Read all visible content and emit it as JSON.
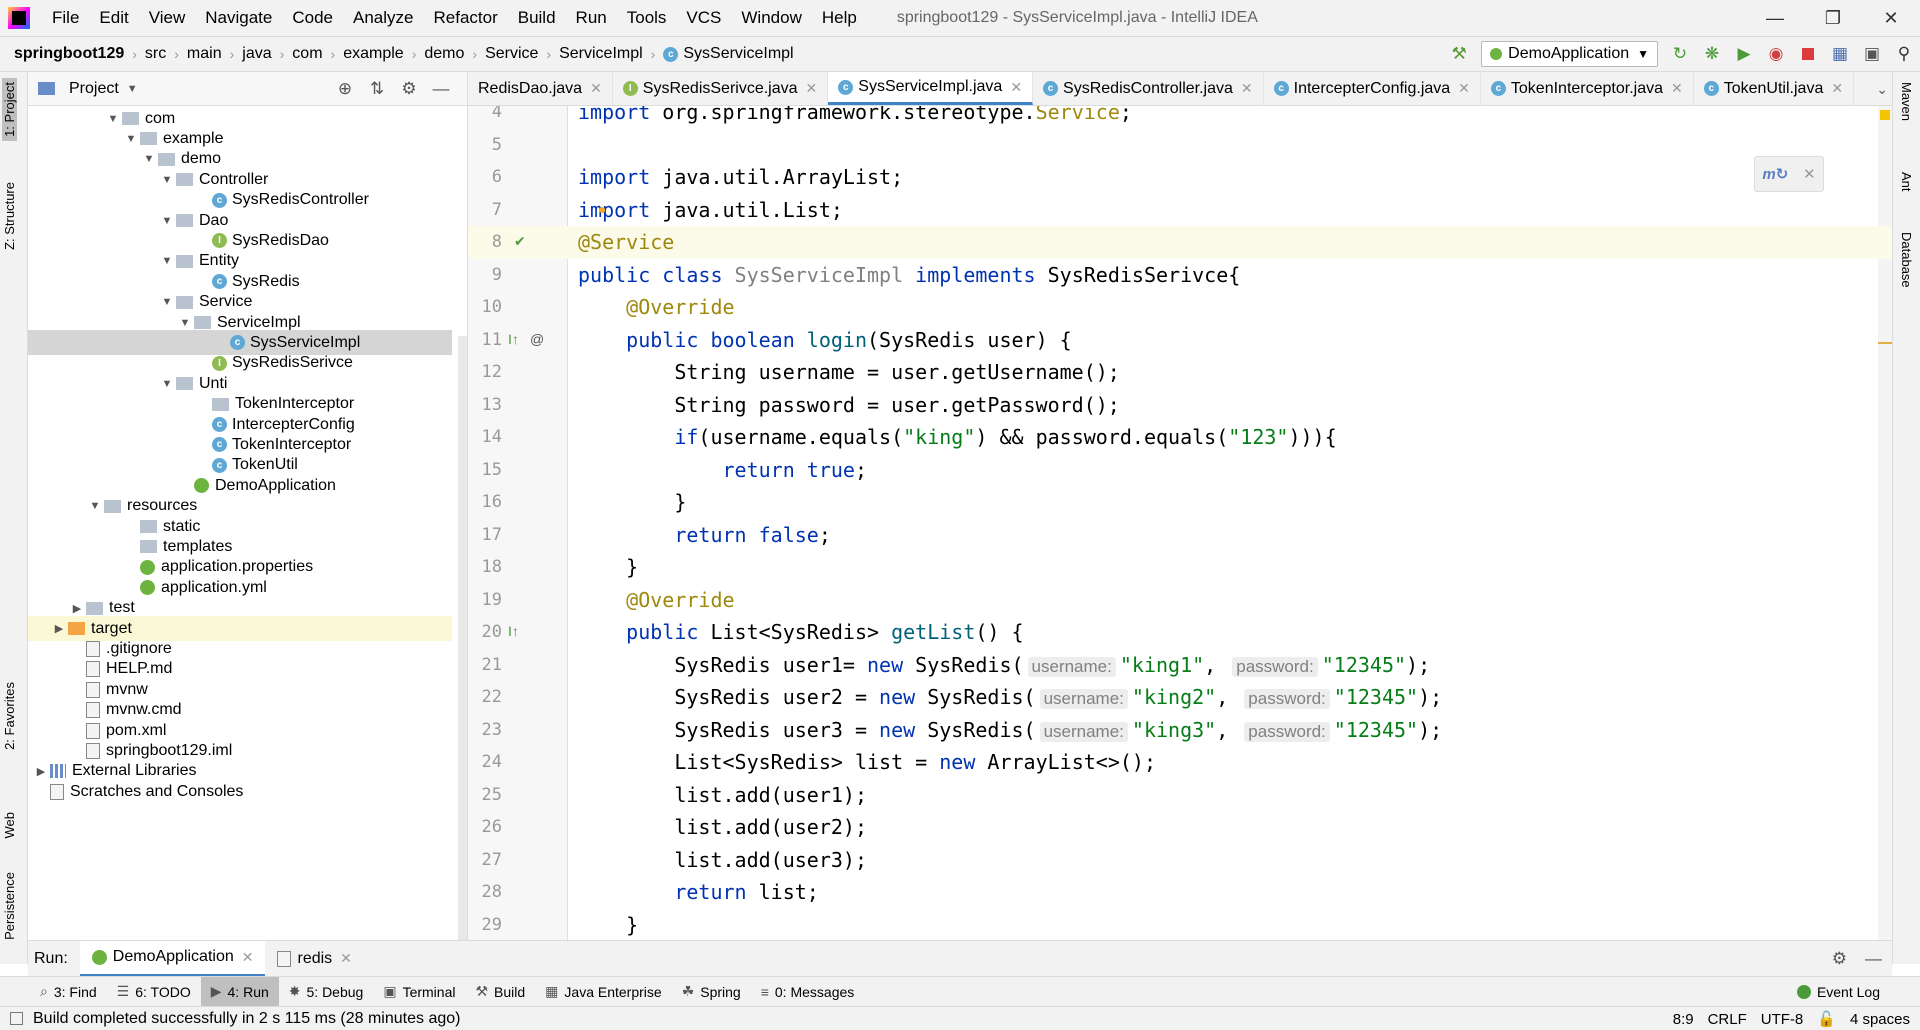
{
  "menu": {
    "items": [
      "File",
      "Edit",
      "View",
      "Navigate",
      "Code",
      "Analyze",
      "Refactor",
      "Build",
      "Run",
      "Tools",
      "VCS",
      "Window",
      "Help"
    ],
    "window_title": "springboot129 - SysServiceImpl.java - IntelliJ IDEA"
  },
  "breadcrumb": [
    "springboot129",
    "src",
    "main",
    "java",
    "com",
    "example",
    "demo",
    "Service",
    "ServiceImpl",
    "SysServiceImpl"
  ],
  "run_config": "DemoApplication",
  "left_stripe": {
    "project": "1: Project",
    "structure": "Z: Structure",
    "favorites": "2: Favorites",
    "web": "Web",
    "persistence": "Persistence"
  },
  "right_stripe": {
    "maven": "Maven",
    "ant": "Ant",
    "database": "Database"
  },
  "project_panel": {
    "title": "Project",
    "tree": [
      {
        "label": "com",
        "type": "package",
        "level": 4,
        "expanded": true
      },
      {
        "label": "example",
        "type": "package",
        "level": 5,
        "expanded": true
      },
      {
        "label": "demo",
        "type": "package",
        "level": 6,
        "expanded": true
      },
      {
        "label": "Controller",
        "type": "package",
        "level": 7,
        "expanded": true
      },
      {
        "label": "SysRedisController",
        "type": "class",
        "level": 9
      },
      {
        "label": "Dao",
        "type": "package",
        "level": 7,
        "expanded": true
      },
      {
        "label": "SysRedisDao",
        "type": "interface",
        "level": 9
      },
      {
        "label": "Entity",
        "type": "package",
        "level": 7,
        "expanded": true
      },
      {
        "label": "SysRedis",
        "type": "class",
        "level": 9
      },
      {
        "label": "Service",
        "type": "package",
        "level": 7,
        "expanded": true
      },
      {
        "label": "ServiceImpl",
        "type": "package",
        "level": 8,
        "expanded": true
      },
      {
        "label": "SysServiceImpl",
        "type": "class",
        "level": 10,
        "selected": true
      },
      {
        "label": "SysRedisSerivce",
        "type": "interface",
        "level": 9
      },
      {
        "label": "Unti",
        "type": "package",
        "level": 7,
        "expanded": true
      },
      {
        "label": "TokenInterceptor",
        "type": "package",
        "level": 9
      },
      {
        "label": "IntercepterConfig",
        "type": "class",
        "level": 9
      },
      {
        "label": "TokenInterceptor",
        "type": "class",
        "level": 9
      },
      {
        "label": "TokenUtil",
        "type": "class",
        "level": 9
      },
      {
        "label": "DemoApplication",
        "type": "spring",
        "level": 8
      },
      {
        "label": "resources",
        "type": "folder",
        "level": 3,
        "expanded": true
      },
      {
        "label": "static",
        "type": "folder",
        "level": 5
      },
      {
        "label": "templates",
        "type": "folder",
        "level": 5
      },
      {
        "label": "application.properties",
        "type": "spring",
        "level": 5
      },
      {
        "label": "application.yml",
        "type": "spring",
        "level": 5
      },
      {
        "label": "test",
        "type": "folder",
        "level": 2,
        "collapsed": true
      },
      {
        "label": "target",
        "type": "folder-orange",
        "level": 1,
        "collapsed": true,
        "highlight": true
      },
      {
        "label": ".gitignore",
        "type": "file",
        "level": 2
      },
      {
        "label": "HELP.md",
        "type": "file",
        "level": 2
      },
      {
        "label": "mvnw",
        "type": "file",
        "level": 2
      },
      {
        "label": "mvnw.cmd",
        "type": "file",
        "level": 2
      },
      {
        "label": "pom.xml",
        "type": "file",
        "level": 2
      },
      {
        "label": "springboot129.iml",
        "type": "file",
        "level": 2
      },
      {
        "label": "External Libraries",
        "type": "lib",
        "level": 0,
        "collapsed": true
      },
      {
        "label": "Scratches and Consoles",
        "type": "file",
        "level": 0
      }
    ]
  },
  "editor_tabs": [
    {
      "label": "RedisDao.java",
      "icon": "none",
      "active": false
    },
    {
      "label": "SysRedisSerivce.java",
      "icon": "interface",
      "active": false
    },
    {
      "label": "SysServiceImpl.java",
      "icon": "class",
      "active": true
    },
    {
      "label": "SysRedisController.java",
      "icon": "class",
      "active": false
    },
    {
      "label": "IntercepterConfig.java",
      "icon": "class",
      "active": false
    },
    {
      "label": "TokenInterceptor.java",
      "icon": "class",
      "active": false
    },
    {
      "label": "TokenUtil.java",
      "icon": "class",
      "active": false
    }
  ],
  "editor": {
    "lines": [
      {
        "n": "4",
        "code": [
          [
            "kw",
            "import "
          ],
          [
            "",
            "org.springframework.stereotype."
          ],
          [
            "ann",
            "Service"
          ],
          [
            "",
            ";"
          ]
        ]
      },
      {
        "n": "5",
        "code": []
      },
      {
        "n": "6",
        "code": [
          [
            "kw",
            "import "
          ],
          [
            "",
            "java.util.ArrayList;"
          ]
        ]
      },
      {
        "n": "7",
        "code": [
          [
            "kw",
            "import "
          ],
          [
            "",
            "java.util.List;"
          ]
        ]
      },
      {
        "n": "8",
        "code": [
          [
            "ann",
            "@Service"
          ]
        ],
        "current": true
      },
      {
        "n": "9",
        "code": [
          [
            "kw",
            "public class "
          ],
          [
            "cls-gray",
            "SysServiceImpl "
          ],
          [
            "kw",
            "implements "
          ],
          [
            "",
            "SysRedisSerivce{"
          ]
        ]
      },
      {
        "n": "10",
        "code": [
          [
            "",
            "    "
          ],
          [
            "ann",
            "@Override"
          ]
        ]
      },
      {
        "n": "11",
        "code": [
          [
            "",
            "    "
          ],
          [
            "kw",
            "public boolean "
          ],
          [
            "fn",
            "login"
          ],
          [
            "",
            "(SysRedis user) {"
          ]
        ]
      },
      {
        "n": "12",
        "code": [
          [
            "",
            "        String username = user.getUsername();"
          ]
        ]
      },
      {
        "n": "13",
        "code": [
          [
            "",
            "        String password = user.getPassword();"
          ]
        ]
      },
      {
        "n": "14",
        "code": [
          [
            "",
            "        "
          ],
          [
            "kw",
            "if"
          ],
          [
            "",
            "(username.equals("
          ],
          [
            "str",
            "\"king\""
          ],
          [
            "",
            ") && password.equals("
          ],
          [
            "str",
            "\"123\""
          ],
          [
            "",
            "))){"
          ]
        ]
      },
      {
        "n": "15",
        "code": [
          [
            "",
            "            "
          ],
          [
            "kw",
            "return true"
          ],
          [
            "",
            ";"
          ]
        ]
      },
      {
        "n": "16",
        "code": [
          [
            "",
            "        }"
          ]
        ]
      },
      {
        "n": "17",
        "code": [
          [
            "",
            "        "
          ],
          [
            "kw",
            "return false"
          ],
          [
            "",
            ";"
          ]
        ]
      },
      {
        "n": "18",
        "code": [
          [
            "",
            "    }"
          ]
        ]
      },
      {
        "n": "19",
        "code": [
          [
            "",
            "    "
          ],
          [
            "ann",
            "@Override"
          ]
        ]
      },
      {
        "n": "20",
        "code": [
          [
            "",
            "    "
          ],
          [
            "kw",
            "public "
          ],
          [
            "",
            "List<SysRedis> "
          ],
          [
            "fn",
            "getList"
          ],
          [
            "",
            "() {"
          ]
        ]
      },
      {
        "n": "21",
        "code": [
          [
            "",
            "        SysRedis user1= "
          ],
          [
            "kw",
            "new "
          ],
          [
            "",
            "SysRedis("
          ],
          [
            "hint",
            "username:"
          ],
          [
            "str",
            "\"king1\""
          ],
          [
            "",
            ", "
          ],
          [
            "hint",
            "password:"
          ],
          [
            "str",
            "\"12345\""
          ],
          [
            "",
            ");"
          ]
        ]
      },
      {
        "n": "22",
        "code": [
          [
            "",
            "        SysRedis user2 = "
          ],
          [
            "kw",
            "new "
          ],
          [
            "",
            "SysRedis("
          ],
          [
            "hint",
            "username:"
          ],
          [
            "str",
            "\"king2\""
          ],
          [
            "",
            ", "
          ],
          [
            "hint",
            "password:"
          ],
          [
            "str",
            "\"12345\""
          ],
          [
            "",
            ");"
          ]
        ]
      },
      {
        "n": "23",
        "code": [
          [
            "",
            "        SysRedis user3 = "
          ],
          [
            "kw",
            "new "
          ],
          [
            "",
            "SysRedis("
          ],
          [
            "hint",
            "username:"
          ],
          [
            "str",
            "\"king3\""
          ],
          [
            "",
            ", "
          ],
          [
            "hint",
            "password:"
          ],
          [
            "str",
            "\"12345\""
          ],
          [
            "",
            ");"
          ]
        ]
      },
      {
        "n": "24",
        "code": [
          [
            "",
            "        List<SysRedis> list = "
          ],
          [
            "kw",
            "new "
          ],
          [
            "",
            "ArrayList<>();"
          ]
        ]
      },
      {
        "n": "25",
        "code": [
          [
            "",
            "        list.add(user1);"
          ]
        ]
      },
      {
        "n": "26",
        "code": [
          [
            "",
            "        list.add(user2);"
          ]
        ]
      },
      {
        "n": "27",
        "code": [
          [
            "",
            "        list.add(user3);"
          ]
        ]
      },
      {
        "n": "28",
        "code": [
          [
            "",
            "        "
          ],
          [
            "kw",
            "return "
          ],
          [
            "",
            "list;"
          ]
        ]
      },
      {
        "n": "29",
        "code": [
          [
            "",
            "    }"
          ]
        ]
      }
    ]
  },
  "run_bar": {
    "label": "Run:",
    "tabs": [
      {
        "label": "DemoApplication",
        "active": true
      },
      {
        "label": "redis",
        "active": false
      }
    ]
  },
  "bottom_tools": [
    {
      "label": "3: Find",
      "icon": "search-icon"
    },
    {
      "label": "6: TODO",
      "icon": "todo-icon"
    },
    {
      "label": "4: Run",
      "icon": "run-icon",
      "active": true
    },
    {
      "label": "5: Debug",
      "icon": "debug-icon"
    },
    {
      "label": "Terminal",
      "icon": "terminal-icon"
    },
    {
      "label": "Build",
      "icon": "build-icon"
    },
    {
      "label": "Java Enterprise",
      "icon": "java-ee-icon"
    },
    {
      "label": "Spring",
      "icon": "spring-icon"
    },
    {
      "label": "0: Messages",
      "icon": "messages-icon"
    }
  ],
  "event_log": "Event Log",
  "status": {
    "message": "Build completed successfully in 2 s 115 ms (28 minutes ago)",
    "position": "8:9",
    "line_ending": "CRLF",
    "encoding": "UTF-8",
    "indent": "4 spaces"
  }
}
